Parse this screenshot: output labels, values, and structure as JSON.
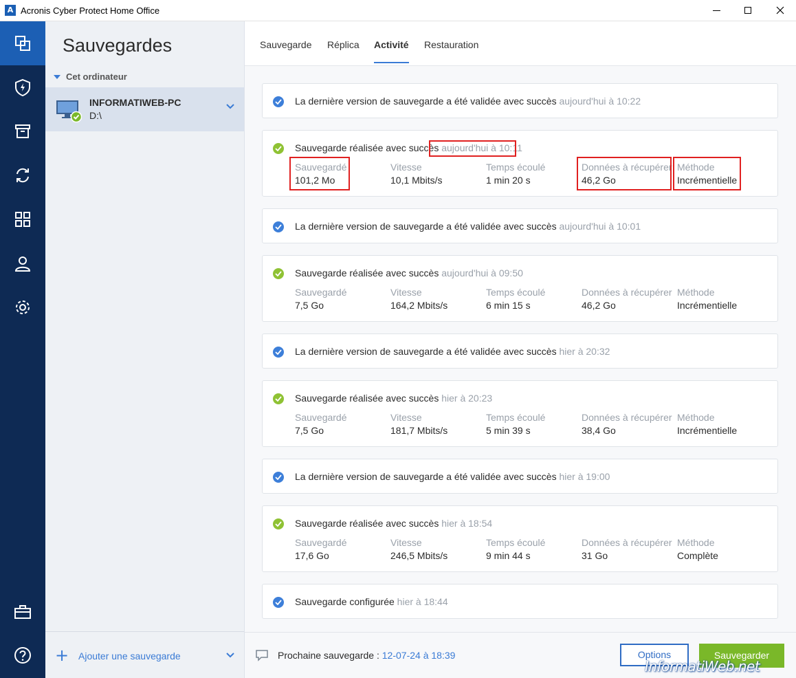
{
  "window": {
    "title": "Acronis Cyber Protect Home Office",
    "app_icon": "A"
  },
  "nav": {
    "items": [
      {
        "icon": "backups-icon",
        "active": true
      },
      {
        "icon": "protection-shield-icon"
      },
      {
        "icon": "archive-icon"
      },
      {
        "icon": "sync-icon"
      },
      {
        "icon": "tools-grid-icon"
      },
      {
        "icon": "account-icon"
      },
      {
        "icon": "settings-gear-icon"
      },
      {
        "icon": "store-icon"
      },
      {
        "icon": "help-icon"
      }
    ],
    "accent": "#0e2a54",
    "active_color": "#1c5fb4"
  },
  "sidebar": {
    "title": "Sauvegardes",
    "section": "Cet ordinateur",
    "item": {
      "name": "INFORMATIWEB-PC",
      "drive": "D:\\"
    },
    "add_label": "Ajouter une sauvegarde"
  },
  "tabs": [
    {
      "label": "Sauvegarde"
    },
    {
      "label": "Réplica"
    },
    {
      "label": "Activité",
      "active": true
    },
    {
      "label": "Restauration"
    }
  ],
  "stat_labels": {
    "saved": "Sauvegardé",
    "speed": "Vitesse",
    "elapsed": "Temps écoulé",
    "recover": "Données à récupérer",
    "method": "Méthode"
  },
  "activity": [
    {
      "type": "validated",
      "text": "La dernière version de sauvegarde a été validée avec succès",
      "time": "aujourd'hui à 10:22"
    },
    {
      "type": "backup",
      "text": "Sauvegarde réalisée avec succès",
      "time": "aujourd'hui à 10:11",
      "saved": "101,2 Mo",
      "speed": "10,1 Mbits/s",
      "elapsed": "1 min 20 s",
      "recover": "46,2 Go",
      "method": "Incrémentielle"
    },
    {
      "type": "validated",
      "text": "La dernière version de sauvegarde a été validée avec succès",
      "time": "aujourd'hui à 10:01"
    },
    {
      "type": "backup",
      "text": "Sauvegarde réalisée avec succès",
      "time": "aujourd'hui à 09:50",
      "saved": "7,5 Go",
      "speed": "164,2 Mbits/s",
      "elapsed": "6 min 15 s",
      "recover": "46,2 Go",
      "method": "Incrémentielle"
    },
    {
      "type": "validated",
      "text": "La dernière version de sauvegarde a été validée avec succès",
      "time": "hier à 20:32"
    },
    {
      "type": "backup",
      "text": "Sauvegarde réalisée avec succès",
      "time": "hier à 20:23",
      "saved": "7,5 Go",
      "speed": "181,7 Mbits/s",
      "elapsed": "5 min 39 s",
      "recover": "38,4 Go",
      "method": "Incrémentielle"
    },
    {
      "type": "validated",
      "text": "La dernière version de sauvegarde a été validée avec succès",
      "time": "hier à 19:00"
    },
    {
      "type": "backup",
      "text": "Sauvegarde réalisée avec succès",
      "time": "hier à 18:54",
      "saved": "17,6 Go",
      "speed": "246,5 Mbits/s",
      "elapsed": "9 min 44 s",
      "recover": "31 Go",
      "method": "Complète"
    },
    {
      "type": "configured",
      "text": "Sauvegarde configurée",
      "time": "hier à 18:44"
    }
  ],
  "bottom": {
    "next_label": "Prochaine sauvegarde : ",
    "next_value": "12-07-24 à 18:39",
    "options_label": "Options",
    "save_label": "Sauvegarder"
  },
  "watermark": "InformatiWeb.net",
  "colors": {
    "blue": "#3d7fd9",
    "green": "#8fc234",
    "highlight": "#e02020",
    "save_button": "#7ab829"
  }
}
